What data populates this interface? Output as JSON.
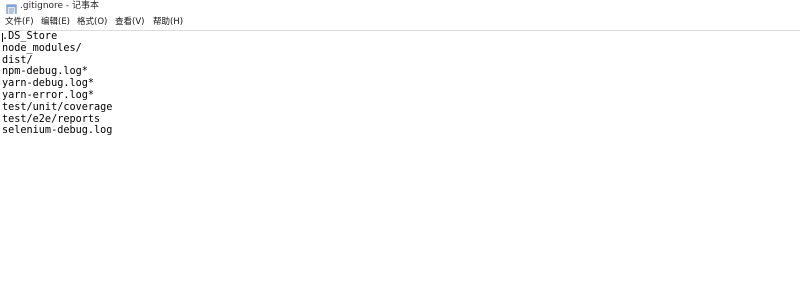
{
  "window": {
    "title": ".gitignore - 记事本",
    "app_icon": "notepad-icon"
  },
  "menu": {
    "items": [
      {
        "label": "文件(F)"
      },
      {
        "label": "编辑(E)"
      },
      {
        "label": "格式(O)"
      },
      {
        "label": "查看(V)"
      },
      {
        "label": "帮助(H)"
      }
    ]
  },
  "editor": {
    "lines": [
      ".DS_Store",
      "node_modules/",
      "dist/",
      "npm-debug.log*",
      "yarn-debug.log*",
      "yarn-error.log*",
      "test/unit/coverage",
      "test/e2e/reports",
      "selenium-debug.log"
    ]
  }
}
